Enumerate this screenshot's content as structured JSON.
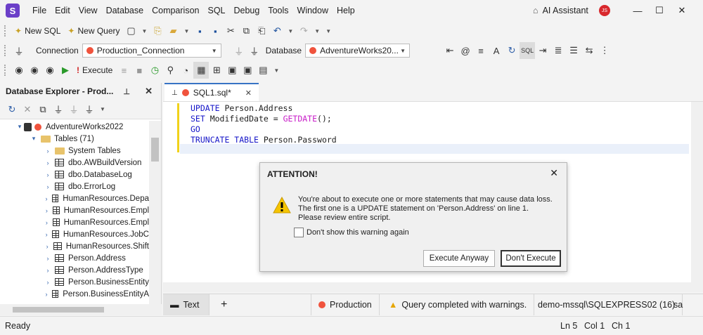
{
  "app": {
    "logo_letter": "S"
  },
  "menu": [
    "File",
    "Edit",
    "View",
    "Database",
    "Comparison",
    "SQL",
    "Debug",
    "Tools",
    "Window",
    "Help"
  ],
  "ai_assistant": "AI Assistant",
  "avatar_initials": "JS",
  "toolbar1": {
    "new_sql": "New SQL",
    "new_query": "New Query"
  },
  "toolbar2": {
    "connection_label": "Connection",
    "connection_value": "Production_Connection",
    "database_label": "Database",
    "database_value": "AdventureWorks20..."
  },
  "toolbar3": {
    "execute": "Execute"
  },
  "explorer": {
    "title": "Database Explorer - Prod...",
    "tree": [
      {
        "label": "AdventureWorks2022",
        "type": "db",
        "indent": 0
      },
      {
        "label": "Tables (71)",
        "type": "folder",
        "indent": 1
      },
      {
        "label": "System Tables",
        "type": "folder",
        "indent": 2
      },
      {
        "label": "dbo.AWBuildVersion",
        "type": "table",
        "indent": 2
      },
      {
        "label": "dbo.DatabaseLog",
        "type": "table",
        "indent": 2
      },
      {
        "label": "dbo.ErrorLog",
        "type": "table",
        "indent": 2
      },
      {
        "label": "HumanResources.Depa",
        "type": "table",
        "indent": 2
      },
      {
        "label": "HumanResources.Empl",
        "type": "table",
        "indent": 2
      },
      {
        "label": "HumanResources.Empl",
        "type": "table",
        "indent": 2
      },
      {
        "label": "HumanResources.JobC",
        "type": "table",
        "indent": 2
      },
      {
        "label": "HumanResources.Shift",
        "type": "table",
        "indent": 2
      },
      {
        "label": "Person.Address",
        "type": "table",
        "indent": 2
      },
      {
        "label": "Person.AddressType",
        "type": "table",
        "indent": 2
      },
      {
        "label": "Person.BusinessEntity",
        "type": "table",
        "indent": 2
      },
      {
        "label": "Person.BusinessEntityA",
        "type": "table",
        "indent": 2
      }
    ]
  },
  "editor": {
    "tab_label": "SQL1.sql*",
    "lines": [
      [
        {
          "t": "UPDATE ",
          "c": "kw"
        },
        {
          "t": "Person.Address",
          "c": "plain"
        }
      ],
      [
        {
          "t": "SET ",
          "c": "kw"
        },
        {
          "t": "ModifiedDate = ",
          "c": "plain"
        },
        {
          "t": "GETDATE",
          "c": "fn"
        },
        {
          "t": "();",
          "c": "plain"
        }
      ],
      [
        {
          "t": "GO",
          "c": "kw"
        }
      ],
      [
        {
          "t": "TRUNCATE TABLE ",
          "c": "kw"
        },
        {
          "t": "Person.Password",
          "c": "plain"
        }
      ]
    ]
  },
  "docbar": {
    "text_tab": "Text",
    "add": "+",
    "connection": "Production",
    "status": "Query completed with warnings.",
    "server": "demo-mssql\\SQLEXPRESS02 (16)",
    "user": "sa"
  },
  "statusbar": {
    "ready": "Ready",
    "ln": "Ln 5",
    "col": "Col 1",
    "ch": "Ch 1"
  },
  "dialog": {
    "title": "ATTENTION!",
    "message1": "You're about to execute one or more statements that may cause data loss.",
    "message2": "The first one is a UPDATE statement on 'Person.Address' on line 1.",
    "message3": "Please review entire script.",
    "checkbox": "Don't show this warning again",
    "execute_anyway": "Execute Anyway",
    "dont_execute": "Don't Execute"
  },
  "colors": {
    "accent": "#3873c4",
    "brand": "#6b3fc8",
    "danger": "#f0533d",
    "warning": "#f5c400"
  }
}
